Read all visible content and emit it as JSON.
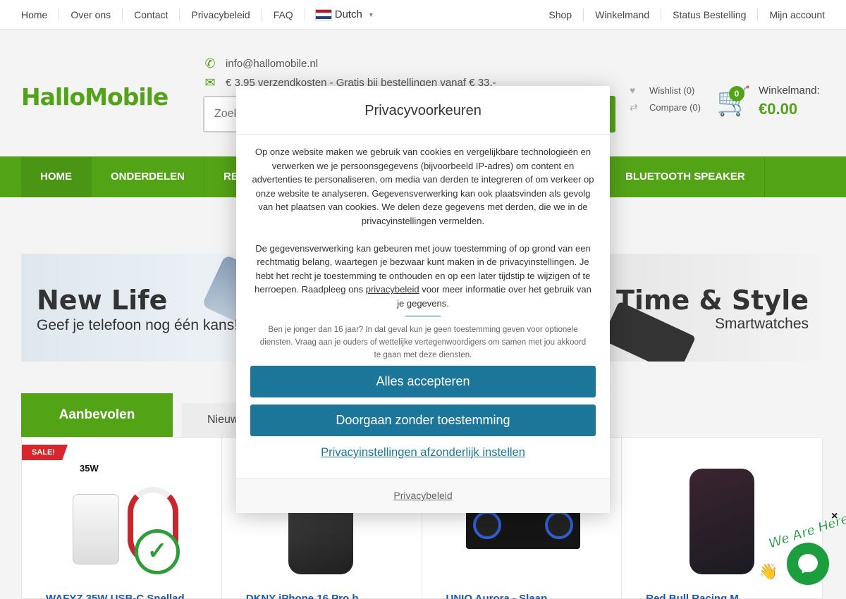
{
  "topbar": {
    "left_links": [
      "Home",
      "Over ons",
      "Contact",
      "Privacybeleid",
      "FAQ"
    ],
    "language": "Dutch",
    "right_links": [
      "Shop",
      "Winkelmand",
      "Status Bestelling",
      "Mijn account"
    ]
  },
  "header": {
    "logo": "HalloMobile",
    "email": "info@hallomobile.nl",
    "shipping": "€ 3,95 verzendkosten - Gratis bij bestellingen vanaf € 33,-",
    "search_placeholder": "Zoek",
    "wishlist": "Wishlist (0)",
    "compare": "Compare (0)",
    "cart_count": "0",
    "cart_label": "Winkelmand:",
    "cart_total": "€0.00"
  },
  "nav": {
    "items": [
      "HOME",
      "ONDERDELEN",
      "RE",
      "BLUETOOTH SPEAKER"
    ]
  },
  "banners": {
    "left_title": "New Life",
    "left_sub": "Geef je telefoon nog één kans!",
    "right_title": "Time & Style",
    "right_sub": "Smartwatches"
  },
  "tabs": {
    "active": "Aanbevolen",
    "other": "Nieuw"
  },
  "products": {
    "sale_badge": "SALE!",
    "badge_35w": "35W",
    "titles": [
      "WAFYZ 35W USB-C Snellad",
      "DKNY iPhone 16 Pro b",
      "UNIQ Aurora - Slaap",
      "Red Bull Racing M"
    ]
  },
  "modal": {
    "title": "Privacyvoorkeuren",
    "para1": "Op onze website maken we gebruik van cookies en vergelijkbare technologieën en verwerken we je persoonsgegevens (bijvoorbeeld IP-adres) om content en advertenties te personaliseren, om media van derden te integreren of om verkeer op onze website te analyseren. Gegevensverwerking kan ook plaatsvinden als gevolg van het plaatsen van cookies. We delen deze gegevens met derden, die we in de privacyinstellingen vermelden.",
    "para2_before": "De gegevensverwerking kan gebeuren met jouw toestemming of op grond van een rechtmatig belang, waartegen je bezwaar kunt maken in de privacyinstellingen. Je hebt het recht je toestemming te onthouden en op een later tijdstip te wijzigen of te herroepen. Raadpleeg ons ",
    "para2_link": "privacybeleid",
    "para2_after": " voor meer informatie over het gebruik van je gegevens.",
    "note": "Ben je jonger dan 16 jaar? In dat geval kun je geen toestemming geven voor optionele diensten. Vraag aan je ouders of wettelijke vertegenwoordigers om samen met jou akkoord te gaan met deze diensten.",
    "accept_all": "Alles accepteren",
    "continue_without": "Doorgaan zonder toestemming",
    "settings_link": "Privacyinstellingen afzonderlijk instellen",
    "footer_link": "Privacybeleid"
  },
  "chat": {
    "label": "We Are Here!",
    "close": "×"
  },
  "colors": {
    "brand_green": "#53a317",
    "modal_button": "#1c7699",
    "sale_red": "#d9262c"
  }
}
